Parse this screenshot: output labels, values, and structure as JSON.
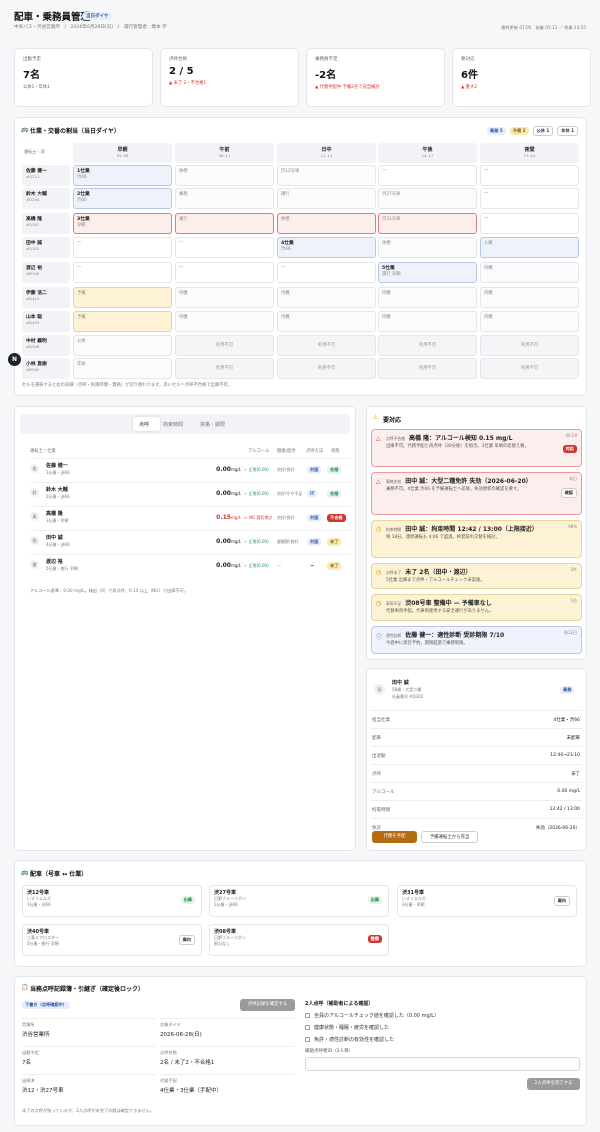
{
  "header": {
    "title": "配車・乗務員管理",
    "today_badge": "当日ダイヤ",
    "sub": "中央バス・渋谷営業所　/　2026年6月28日(日)　/　運行管理者：橋本 学",
    "meta": "最終更新 07:05　始業 05:12 ／ 終業 23:55"
  },
  "kpis": [
    {
      "label": "出勤予定",
      "value": "7名",
      "sub": "公休1・年休1"
    },
    {
      "label": "点呼合格",
      "value": "2 / 5",
      "sub": "未了 2・不合格1"
    },
    {
      "label": "乗務員不足",
      "value": "-2名",
      "sub": "代務手配中 予備2名で充当検討"
    },
    {
      "label": "要対応",
      "value": "6件",
      "sub": "重大2"
    }
  ],
  "grid": {
    "title": "仕業・交番の割当（当日ダイヤ）",
    "legend": [
      "乗務 5",
      "予備 2",
      "公休 1",
      "年休 1"
    ],
    "corner": "運転士＼帯",
    "columns": [
      {
        "n": "早朝",
        "t": "05–08"
      },
      {
        "n": "午前",
        "t": "08–11"
      },
      {
        "n": "日中",
        "t": "11–14"
      },
      {
        "n": "午後",
        "t": "14–17"
      },
      {
        "n": "夜間",
        "t": "17–24"
      }
    ],
    "drivers": [
      {
        "name": "佐藤 健一",
        "id": "#D221"
      },
      {
        "name": "鈴木 大輔",
        "id": "#D244"
      },
      {
        "name": "高橋 隆",
        "id": "#D267"
      },
      {
        "name": "田中 誠",
        "id": "#D302"
      },
      {
        "name": "渡辺 裕",
        "id": "#D340"
      },
      {
        "name": "伊藤 浩二",
        "id": "#D410"
      },
      {
        "name": "山本 聡",
        "id": "#D455"
      },
      {
        "name": "中村 義明",
        "id": "#D508"
      },
      {
        "name": "小林 直樹",
        "id": "#D560"
      }
    ],
    "cells": [
      [
        {
          "t": "1仕業",
          "s": "渋66",
          "k": "blue"
        },
        {
          "s": "休憩",
          "k": "plain"
        },
        {
          "s": "渋12号車",
          "k": "plain"
        },
        {
          "s": "—",
          "k": "out"
        },
        {
          "s": "—",
          "k": "out"
        }
      ],
      [
        {
          "t": "2仕業",
          "s": "渋66",
          "k": "blue"
        },
        {
          "s": "乗務",
          "k": "plain"
        },
        {
          "s": "運行",
          "k": "plain"
        },
        {
          "s": "渋27号車",
          "k": "plain"
        },
        {
          "s": "—",
          "k": "out"
        }
      ],
      [
        {
          "t": "3仕業",
          "s": "早朝",
          "k": "red"
        },
        {
          "s": "運行",
          "k": "red"
        },
        {
          "s": "休憩",
          "k": "red"
        },
        {
          "s": "渋31号車",
          "k": "red"
        },
        {
          "s": "—",
          "k": "out"
        }
      ],
      [
        {
          "s": "—",
          "k": "out"
        },
        {
          "s": "—",
          "k": "out"
        },
        {
          "t": "4仕業",
          "s": "渋66",
          "k": "blue"
        },
        {
          "s": "休憩",
          "k": "plain"
        },
        {
          "s": "入庫",
          "k": "blue"
        }
      ],
      [
        {
          "s": "—",
          "k": "out"
        },
        {
          "s": "—",
          "k": "out"
        },
        {
          "s": "—",
          "k": "out"
        },
        {
          "t": "5仕業",
          "s": "夜行 早朝",
          "k": "blue"
        },
        {
          "s": "待機",
          "k": "plain"
        }
      ],
      [
        {
          "s": "予備",
          "k": "yel"
        },
        {
          "s": "待機",
          "k": "plain"
        },
        {
          "s": "待機",
          "k": "plain"
        },
        {
          "s": "待機",
          "k": "plain"
        },
        {
          "s": "待機",
          "k": "plain"
        }
      ],
      [
        {
          "s": "予備",
          "k": "yel"
        },
        {
          "s": "待機",
          "k": "plain"
        },
        {
          "s": "待機",
          "k": "plain"
        },
        {
          "s": "待機",
          "k": "plain"
        },
        {
          "s": "待機",
          "k": "plain"
        }
      ],
      [
        {
          "s": "公休",
          "k": "plain"
        },
        {
          "s": "利用不可",
          "k": "dis"
        },
        {
          "s": "利用不可",
          "k": "dis"
        },
        {
          "s": "利用不可",
          "k": "dis"
        },
        {
          "s": "利用不可",
          "k": "dis"
        }
      ],
      [
        {
          "s": "年休",
          "k": "plain"
        },
        {
          "s": "利用不可",
          "k": "dis"
        },
        {
          "s": "利用不可",
          "k": "dis"
        },
        {
          "s": "利用不可",
          "k": "dis"
        },
        {
          "s": "利用不可",
          "k": "dis"
        }
      ]
    ],
    "note": "セルを選択すると右の詳細（点呼・拘束時間・資格）が切り替わります。赤いセル＝点呼不合格で出庫不可。"
  },
  "tenko": {
    "tabs": [
      "点呼",
      "拘束時間",
      "資格・期限"
    ],
    "head": {
      "driver": "運転士 / 仕業",
      "alc": "アルコール",
      "health": "健康/疲労",
      "method": "点呼方法",
      "status": "状態"
    },
    "rows": [
      {
        "av": "佐",
        "name": "佐藤 健一",
        "sub": "1仕業・渋66",
        "val": "0.00",
        "unit": "mg/L",
        "chk": "✓ 正常(0.00)",
        "hl": "良好/良好",
        "m": "対面",
        "st": "合格",
        "stk": "green",
        "vk": ""
      },
      {
        "av": "鈴",
        "name": "鈴木 大輔",
        "sub": "2仕業・渋66",
        "val": "0.00",
        "unit": "mg/L",
        "chk": "✓ 正常(0.00)",
        "hl": "良好/やや不足",
        "m": "IT",
        "st": "合格",
        "stk": "green",
        "vk": ""
      },
      {
        "av": "高",
        "name": "高橋 隆",
        "sub": "3仕業・早朝",
        "val": "0.15",
        "unit": "mg/L",
        "chk": "⚠ NG 酒気帯び",
        "hl": "良好/良好",
        "m": "対面",
        "st": "不合格",
        "stk": "red",
        "vk": "red"
      },
      {
        "av": "田",
        "name": "田中 誠",
        "sub": "4仕業・渋66",
        "val": "0.00",
        "unit": "mg/L",
        "chk": "✓ 正常(0.00)",
        "hl": "要観察/良好",
        "m": "対面",
        "st": "未了",
        "stk": "yel",
        "vk": ""
      },
      {
        "av": "渡",
        "name": "渡辺 裕",
        "sub": "5仕業・夜行 早朝",
        "val": "0.00",
        "unit": "mg/L",
        "chk": "✓ 正常(0.00)",
        "hl": "—",
        "m": "—",
        "st": "未了",
        "stk": "yel",
        "vk": ""
      }
    ],
    "note": "アルコール基準：0.00 mg/L。検出（0）で再点呼、0.15 以上（NG）で出庫不可。"
  },
  "alerts": {
    "title": "要対応",
    "items": [
      {
        "ic": "△",
        "tag": "点呼不合格",
        "title": "高橋 隆：アルコール検知 0.15 mg/L",
        "desc": "出庫不可。代務手配と再点呼（30分後）を指示。3仕業 早朝の差替え要。",
        "time": "06:58",
        "btn": "対応",
        "k": "red"
      },
      {
        "ic": "△",
        "tag": "資格失効",
        "title": "田中 誠：大型二種免許 失効（2026-06-20）",
        "desc": "乗務不可。4仕業 渋66 を予備運転士へ差替。失効更新の確認を要す。",
        "time": "本日",
        "btn": "確認",
        "k": "red"
      },
      {
        "ic": "◷",
        "tag": "拘束時間",
        "title": "田中 誠：拘束時間 12:42 / 13:00（上限接近）",
        "desc": "残 18分。連続運転も 4:06 で超過。終発前の交替を検討。",
        "time": "98%",
        "btn": "",
        "k": "yel"
      },
      {
        "ic": "◷",
        "tag": "点呼未了",
        "title": "未了 2名（田中・渡辺）",
        "desc": "5仕業 出庫まで点呼・アルコールチェック未実施。",
        "time": "2件",
        "btn": "",
        "k": "yel"
      },
      {
        "ic": "◷",
        "tag": "車両不足",
        "title": "渋08号車 整備中 — 予備車なし",
        "desc": "代替車両手配。代車両使用する安全運行がありません。",
        "time": "1台",
        "btn": "",
        "k": "yel"
      },
      {
        "ic": "ⓘ",
        "tag": "適性診断",
        "title": "佐藤 健一：適性診断 受診期限 7/10",
        "desc": "今週中に受診予約。期限超過で乗務制限。",
        "time": "残12日",
        "btn": "",
        "k": "blue"
      }
    ]
  },
  "detail": {
    "av": "田",
    "name": "田中 誠",
    "sub1": "58歳・大型二種",
    "sub2": "社員番号 #D302",
    "badge": "乗務",
    "rows": [
      {
        "k": "担当仕業",
        "v": "4仕業・渋66"
      },
      {
        "k": "配車",
        "v": "未配車"
      },
      {
        "k": "出退勤",
        "v": "12:40→23:10"
      },
      {
        "k": "点呼",
        "v": "未了"
      },
      {
        "k": "アルコール",
        "v": "0.00 mg/L"
      },
      {
        "k": "拘束時間",
        "v": "12:42 / 13:00"
      },
      {
        "k": "免許",
        "v": "失効（2026-06-20）"
      }
    ],
    "btn1": "代務を手配",
    "btn2": "予備運転士から充当"
  },
  "vehicles": {
    "title": "配車（号車 ↔ 仕業）",
    "items": [
      {
        "n": "渋12号車",
        "m": "いすゞエルガ",
        "a": "1仕業・渋66",
        "st": "出庫",
        "k": "green"
      },
      {
        "n": "渋27号車",
        "m": "日野ブルーリボン",
        "a": "2仕業・渋66",
        "st": "出庫",
        "k": "green"
      },
      {
        "n": "渋31号車",
        "m": "いすゞエルガ",
        "a": "3仕業・早朝",
        "st": "庫内",
        "k": "gray"
      },
      {
        "n": "渋40号車",
        "m": "三菱エアロスター",
        "a": "5仕業・夜行 早朝",
        "st": "庫内",
        "k": "gray"
      },
      {
        "n": "渋08号車",
        "m": "日野ブルーリボン",
        "a": "割当なし",
        "st": "整備",
        "k": "red"
      }
    ]
  },
  "ledger": {
    "title": "当務点呼記録簿・引継ぎ（確定後ロック）",
    "draft": "下書き（点呼確認中）",
    "confirm_btn": "点呼記録を確定する",
    "fields": [
      {
        "k": "営業所",
        "v": "渋谷営業所"
      },
      {
        "k": "対象ダイヤ",
        "v": "2026-06-28(日)"
      },
      {
        "k": "出勤予定",
        "v": "7名"
      },
      {
        "k": "点呼合格",
        "v": "2名 / 未了2・不合格1"
      },
      {
        "k": "出庫済",
        "v": "渋12・渋27号車"
      },
      {
        "k": "代務手配",
        "v": "4仕業・3仕業（手配中）"
      }
    ],
    "note": "未了の点呼が残っているか、2人点呼が未完了の間は確定できません。",
    "right_title": "2人点呼（補助者による確認）",
    "checks": [
      "全員のアルコールチェック値を確認した（0.00 mg/L）",
      "健康状態・睡眠・疲労を確認した",
      "免許・適性診断の有効性を確認した"
    ],
    "id_label": "補助点呼者ID（2人目）",
    "id_placeholder": "",
    "complete_btn": "2人点呼を完了する"
  },
  "fab": "N"
}
